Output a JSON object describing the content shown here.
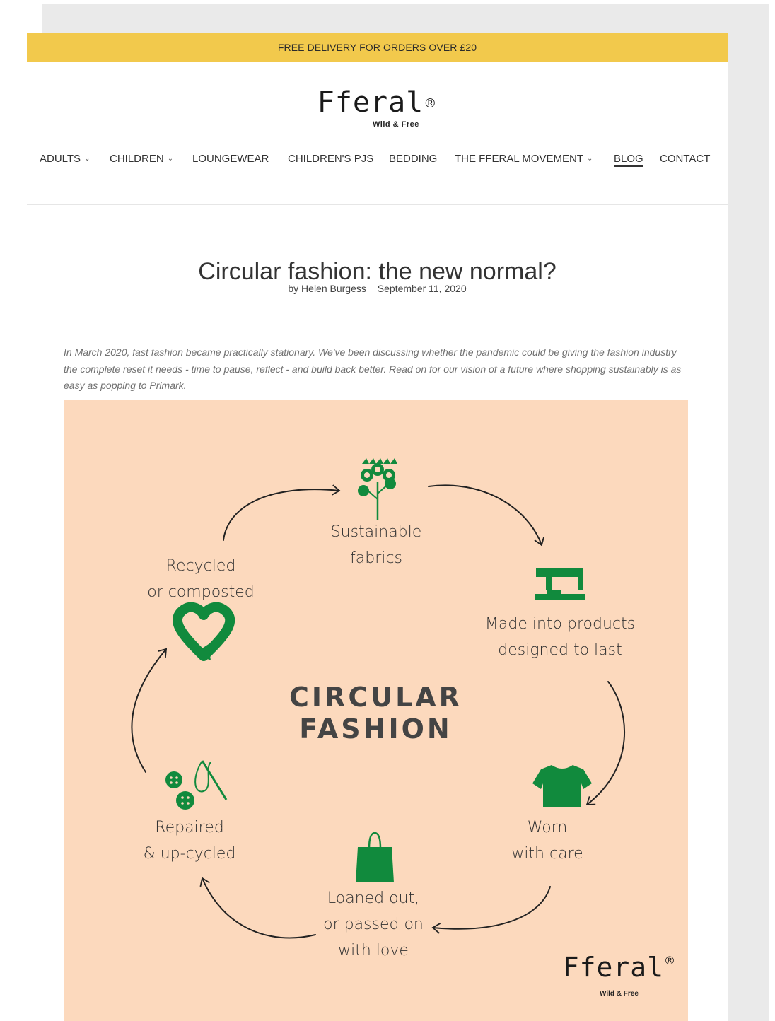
{
  "banner": {
    "text": "FREE DELIVERY FOR ORDERS OVER £20"
  },
  "logo": {
    "name": "Fferal",
    "mark": "®",
    "tagline": "Wild & Free"
  },
  "nav": {
    "items": [
      {
        "label": "ADULTS",
        "has_dropdown": true
      },
      {
        "label": "CHILDREN",
        "has_dropdown": true
      },
      {
        "label": "LOUNGEWEAR",
        "has_dropdown": false
      },
      {
        "label": "CHILDREN'S PJS",
        "has_dropdown": false
      },
      {
        "label": "BEDDING",
        "has_dropdown": false
      },
      {
        "label": "THE FFERAL MOVEMENT",
        "has_dropdown": true
      },
      {
        "label": "BLOG",
        "has_dropdown": false,
        "active": true
      },
      {
        "label": "CONTACT",
        "has_dropdown": false
      }
    ]
  },
  "article": {
    "title": "Circular fashion: the new normal?",
    "author": "by Helen Burgess",
    "date": "September 11, 2020",
    "intro": "In March 2020, fast fashion became practically stationary. We've been discussing whether the pandemic could be giving the fashion industry the complete reset it needs - time to pause, reflect - and build back better. Read on for our vision of a future where shopping sustainably is as easy as popping to Primark."
  },
  "infographic": {
    "title_line1": "CIRCULAR",
    "title_line2": "FASHION",
    "steps": {
      "fabrics": {
        "l1": "Sustainable",
        "l2": "fabrics",
        "icon": "cotton-plant-icon"
      },
      "made": {
        "l1": "Made into products",
        "l2": "designed to last",
        "icon": "sewing-machine-icon"
      },
      "worn": {
        "l1": "Worn",
        "l2": "with care",
        "icon": "tshirt-icon"
      },
      "loaned": {
        "l1": "Loaned out,",
        "l2": "or passed on",
        "l3": "with love",
        "icon": "shopping-bag-icon"
      },
      "repaired": {
        "l1": "Repaired",
        "l2": "& up-cycled",
        "icon": "buttons-needle-icon"
      },
      "recycled": {
        "l1": "Recycled",
        "l2": "or composted",
        "icon": "recycle-heart-icon"
      }
    },
    "watermark": {
      "name": "Fferal",
      "mark": "®",
      "tagline": "Wild & Free"
    },
    "colors": {
      "background": "#fcd9bd",
      "icon_green": "#118a3d",
      "arrow": "#222222"
    }
  }
}
